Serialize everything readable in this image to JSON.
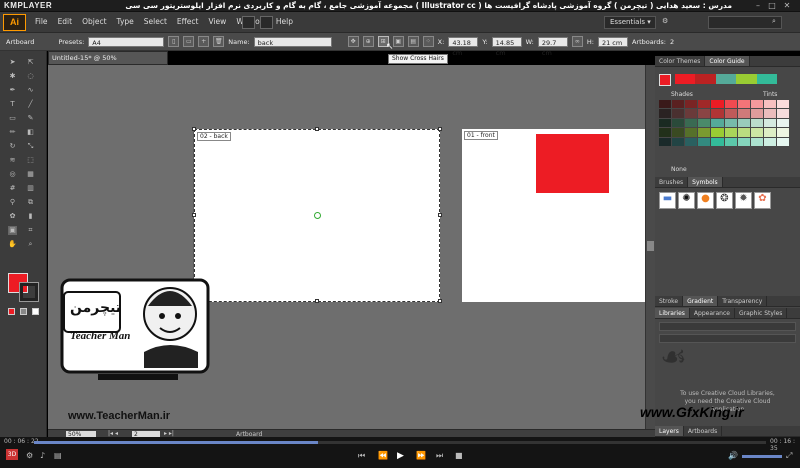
{
  "player": {
    "logo": "KMPLAYER",
    "title": "مجموعه آموزشی جامع ، گام به گام و کاربردی نرم افزار ایلوستریتور سی سی ( Illustrator cc )   مدرس : سعید هدایی ( تیچرمن ) گروه آموزشی پادشاه گرافیست ها",
    "time_elapsed": "00 : 06 : 22",
    "time_total": "00 : 16 : 35"
  },
  "app": {
    "logo": "Ai",
    "menu": [
      "File",
      "Edit",
      "Object",
      "Type",
      "Select",
      "Effect",
      "View",
      "Window",
      "Help"
    ],
    "workspace": "Essentials",
    "search_placeholder": ""
  },
  "control": {
    "mode_label": "Artboard",
    "presets_label": "Presets:",
    "preset_value": "A4",
    "name_label": "Name:",
    "name_value": "back",
    "x_label": "X:",
    "x_value": "43.18 cm",
    "y_label": "Y:",
    "y_value": "14.85 cm",
    "w_label": "W:",
    "w_value": "29.7 cm",
    "h_label": "H:",
    "h_value": "21 cm",
    "artboards_label": "Artboards:",
    "artboards_value": "2"
  },
  "tooltip": "Show Cross Hairs",
  "document": {
    "tab": "Untitled-15* @ 50% (CMYK/Preview)",
    "artboards": [
      {
        "label": "02 - back"
      },
      {
        "label": "01 - front",
        "shape_color": "#ed1c24"
      }
    ]
  },
  "status": {
    "zoom": "50%",
    "page": "2",
    "tool": "Artboard"
  },
  "panels": {
    "color_tabs": [
      "Color Themes",
      "Color Guide"
    ],
    "shades_label": "Shades",
    "tints_label": "Tints",
    "none_label": "None",
    "symbol_tabs": [
      "Brushes",
      "Symbols"
    ],
    "stroke_tabs": [
      "Stroke",
      "Gradient",
      "Transparency"
    ],
    "lib_tabs": [
      "Libraries",
      "Appearance",
      "Graphic Styles"
    ],
    "lib_message": [
      "To use Creative Cloud Libraries,",
      "you need the Creative Cloud",
      "Application"
    ],
    "bottom_tabs": [
      "Layers",
      "Artboards"
    ]
  },
  "overlay": {
    "teacherman_url": "www.TeacherMan.ir",
    "teacherman_name": "Teacher Man",
    "teacherman_fa": "تیچرمن",
    "gfxking": "www.GfxKing.ir"
  },
  "colors": {
    "fill": "#ed1c24",
    "accent_blue": "#6a86c7",
    "ai_orange": "#ff9a00"
  }
}
